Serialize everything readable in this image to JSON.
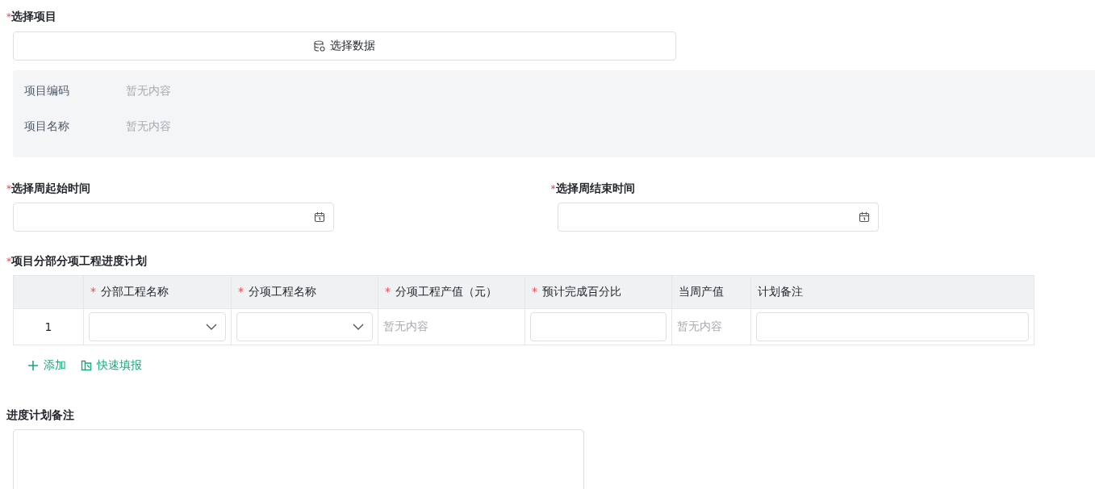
{
  "project": {
    "mark": "*",
    "label": "选择项目",
    "button": "选择数据",
    "info": [
      {
        "label": "项目编码",
        "value": "暂无内容"
      },
      {
        "label": "项目名称",
        "value": "暂无内容"
      }
    ]
  },
  "dates": [
    {
      "mark": "*",
      "label": "选择周起始时间"
    },
    {
      "mark": "*",
      "label": "选择周结束时间"
    }
  ],
  "plan": {
    "mark": "*",
    "label": "项目分部分项工程进度计划",
    "columns": [
      {},
      {
        "mark": "*",
        "label": "分部工程名称"
      },
      {
        "mark": "*",
        "label": "分项工程名称"
      },
      {
        "mark": "*",
        "label": "分项工程产值（元）"
      },
      {
        "mark": "*",
        "label": "预计完成百分比"
      },
      {
        "label": "当周产值"
      },
      {
        "label": "计划备注"
      }
    ],
    "rows": [
      [
        {
          "kind": "index",
          "text": "1"
        },
        {
          "kind": "select"
        },
        {
          "kind": "select"
        },
        {
          "kind": "text",
          "text": "暂无内容"
        },
        {
          "kind": "input"
        },
        {
          "kind": "text",
          "text": "暂无内容"
        },
        {
          "kind": "input"
        }
      ]
    ],
    "actions": [
      {
        "kind": "add",
        "label": "添加"
      },
      {
        "kind": "quick",
        "label": "快速填报"
      }
    ]
  },
  "remark": {
    "label": "进度计划备注"
  }
}
